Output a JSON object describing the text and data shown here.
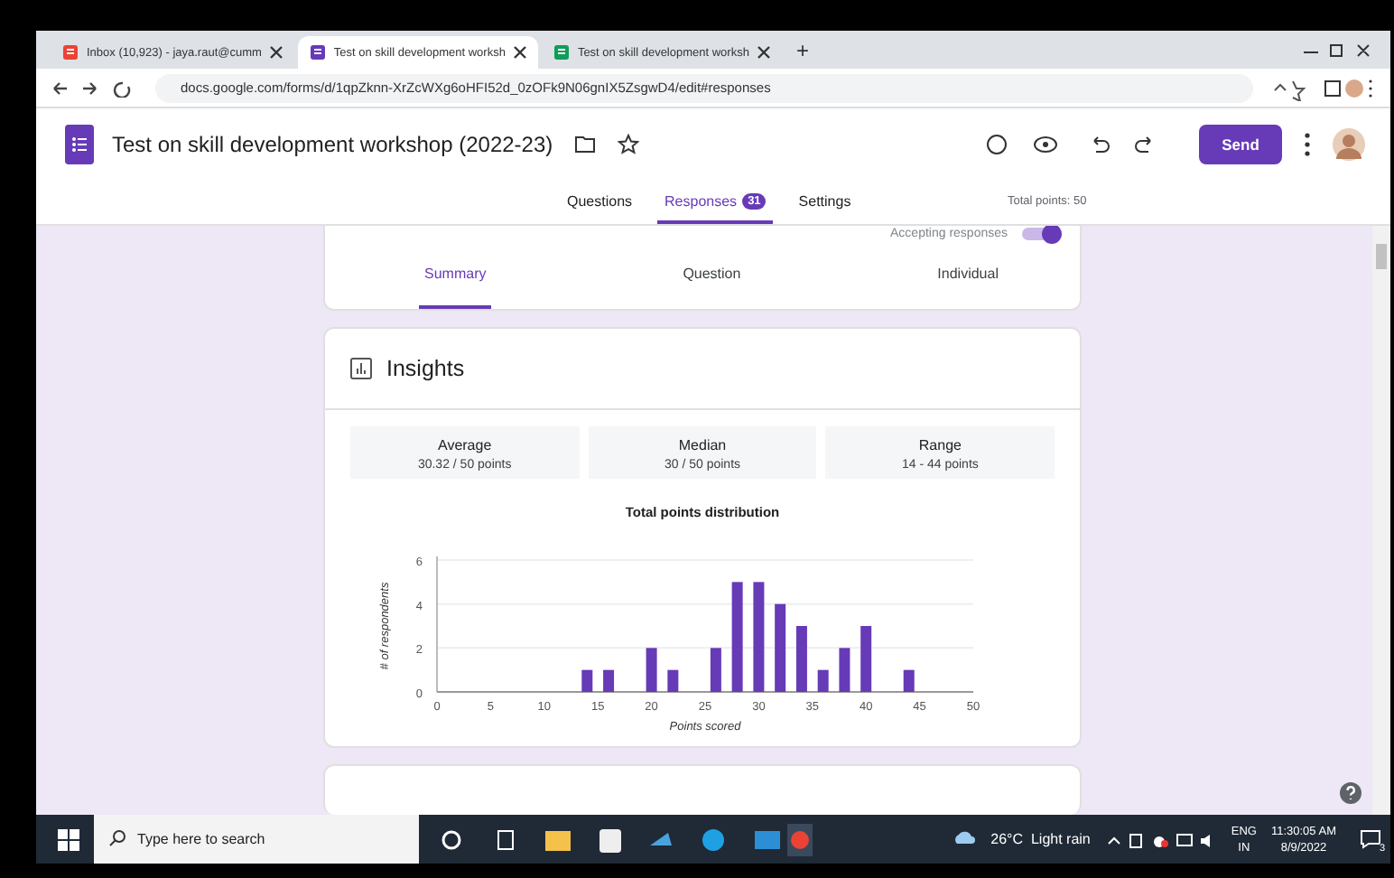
{
  "browser": {
    "tabs": [
      {
        "kind": "gmail",
        "label": "Inbox (10,923) - jaya.raut@cumm",
        "selected": false
      },
      {
        "kind": "forms",
        "label": "Test on skill development worksh",
        "selected": true
      },
      {
        "kind": "sheets",
        "label": "Test on skill development worksh",
        "selected": false
      }
    ],
    "new_tab": "+",
    "url": "docs.google.com/forms/d/1qpZknn-XrZcWXg6oHFI52d_0zOFk9N06gnIX5ZsgwD4/edit#responses"
  },
  "form": {
    "title": "Test on skill development workshop (2022-23)",
    "send": "Send",
    "nav": [
      {
        "label": "Questions",
        "selected": false
      },
      {
        "label": "Responses",
        "badge": "31",
        "selected": true
      },
      {
        "label": "Settings",
        "selected": false
      }
    ],
    "total_points": "Total points: 50"
  },
  "accepting": {
    "label": "Accepting responses",
    "on": true
  },
  "views": [
    {
      "label": "Summary",
      "selected": true
    },
    {
      "label": "Question",
      "selected": false
    },
    {
      "label": "Individual",
      "selected": false
    }
  ],
  "insights": {
    "title": "Insights",
    "stats": [
      {
        "label": "Average",
        "value": "30.32 / 50 points"
      },
      {
        "label": "Median",
        "value": "30 / 50 points"
      },
      {
        "label": "Range",
        "value": "14 - 44 points"
      }
    ],
    "chart_data": {
      "type": "bar",
      "title": "Total points distribution",
      "xlabel": "Points scored",
      "ylabel": "# of respondents",
      "x": [
        14,
        16,
        20,
        22,
        26,
        28,
        30,
        32,
        34,
        36,
        38,
        40,
        44
      ],
      "values": [
        1,
        1,
        2,
        1,
        2,
        5,
        5,
        4,
        3,
        1,
        2,
        3,
        1
      ],
      "xlim": [
        0,
        50
      ],
      "ylim": [
        0,
        6
      ],
      "xticks": [
        0,
        5,
        10,
        15,
        20,
        25,
        30,
        35,
        40,
        45,
        50
      ],
      "yticks": [
        0,
        2,
        4,
        6
      ]
    }
  },
  "taskbar": {
    "search_placeholder": "Type here to search",
    "weather": "26°C  Light rain",
    "lang": "ENG",
    "region": "IN",
    "time": "11:30:05 AM",
    "date": "8/9/2022",
    "notifications": "3"
  }
}
